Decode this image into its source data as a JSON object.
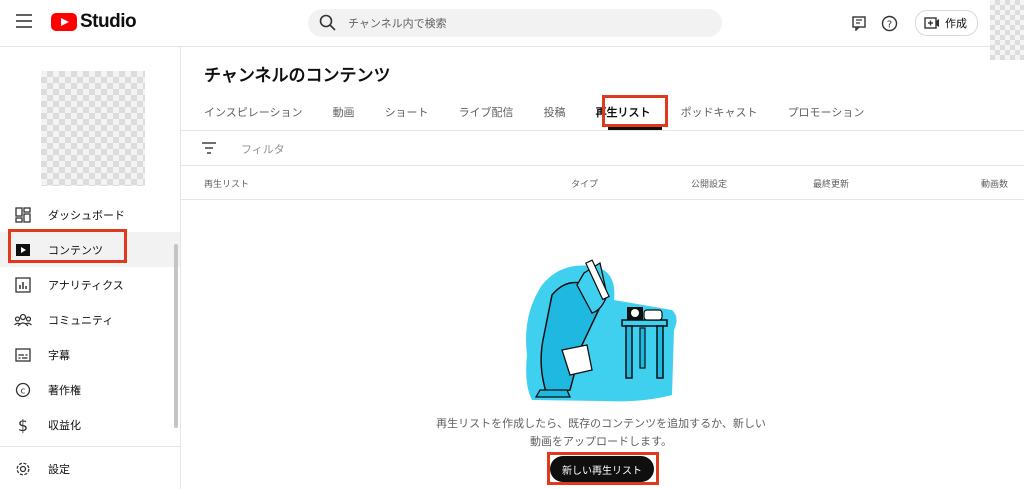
{
  "topbar": {
    "logo_text": "Studio",
    "search_placeholder": "チャンネル内で検索",
    "create_label": "作成"
  },
  "sidebar": {
    "items": [
      {
        "label": "ダッシュボード",
        "icon": "dashboard-icon"
      },
      {
        "label": "コンテンツ",
        "icon": "content-icon",
        "active": true
      },
      {
        "label": "アナリティクス",
        "icon": "analytics-icon"
      },
      {
        "label": "コミュニティ",
        "icon": "community-icon"
      },
      {
        "label": "字幕",
        "icon": "subtitles-icon"
      },
      {
        "label": "著作権",
        "icon": "copyright-icon"
      },
      {
        "label": "収益化",
        "icon": "dollar-icon"
      },
      {
        "label": "設定",
        "icon": "settings-icon"
      }
    ]
  },
  "main": {
    "title": "チャンネルのコンテンツ",
    "tabs": [
      {
        "label": "インスピレーション"
      },
      {
        "label": "動画"
      },
      {
        "label": "ショート"
      },
      {
        "label": "ライブ配信"
      },
      {
        "label": "投稿"
      },
      {
        "label": "再生リスト",
        "active": true
      },
      {
        "label": "ポッドキャスト"
      },
      {
        "label": "プロモーション"
      }
    ],
    "filter_label": "フィルタ",
    "columns": [
      "再生リスト",
      "タイプ",
      "公開設定",
      "最終更新",
      "動画数"
    ],
    "empty_text_line1": "再生リストを作成したら、既存のコンテンツを追加するか、新しい",
    "empty_text_line2": "動画をアップロードします。",
    "new_playlist_button": "新しい再生リスト"
  },
  "colors": {
    "brand_red": "#ff0000",
    "highlight": "#e03a1e",
    "illustration_cyan": "#3fd0f0"
  }
}
